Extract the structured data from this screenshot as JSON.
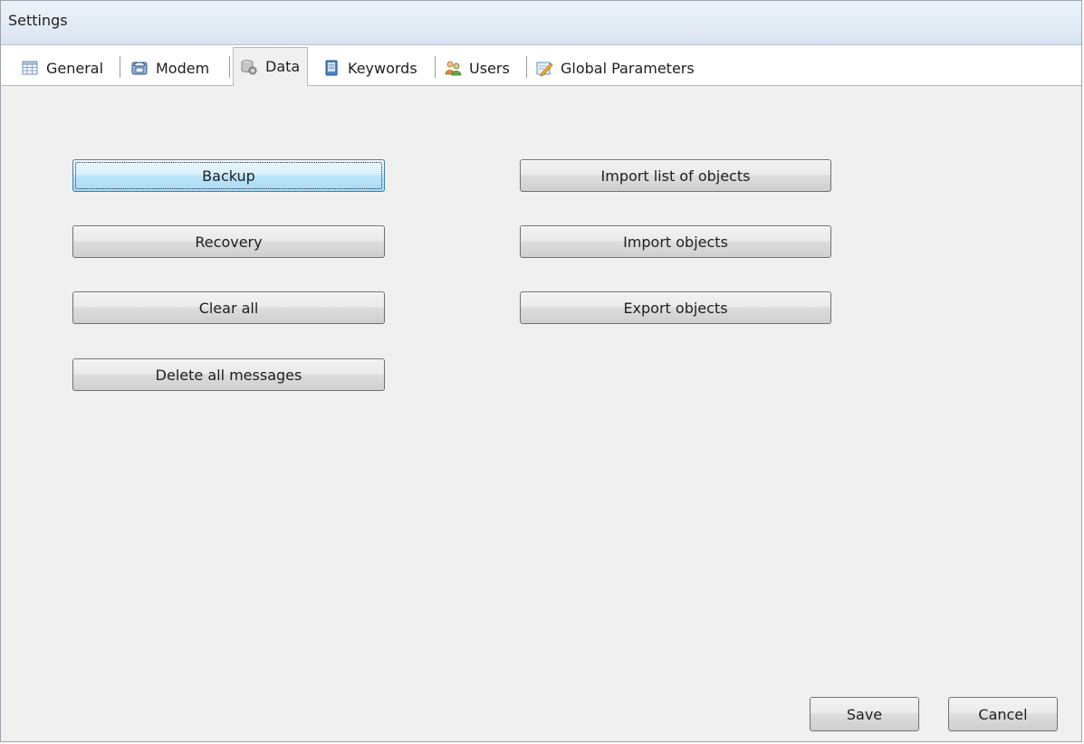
{
  "window": {
    "title": "Settings"
  },
  "tabs": [
    {
      "label": "General",
      "icon": "table-icon",
      "active": false
    },
    {
      "label": "Modem",
      "icon": "phone-icon",
      "active": false
    },
    {
      "label": "Data",
      "icon": "data-gear-icon",
      "active": true
    },
    {
      "label": "Keywords",
      "icon": "book-icon",
      "active": false
    },
    {
      "label": "Users",
      "icon": "users-icon",
      "active": false
    },
    {
      "label": "Global Parameters",
      "icon": "edit-pencil-icon",
      "active": false
    }
  ],
  "data_panel": {
    "left_buttons": [
      {
        "label": "Backup",
        "focused": true
      },
      {
        "label": "Recovery",
        "focused": false
      },
      {
        "label": "Clear all",
        "focused": false
      },
      {
        "label": "Delete all messages",
        "focused": false
      }
    ],
    "right_buttons": [
      {
        "label": "Import list of objects"
      },
      {
        "label": "Import objects"
      },
      {
        "label": "Export objects"
      }
    ]
  },
  "footer": {
    "save_label": "Save",
    "cancel_label": "Cancel"
  },
  "colors": {
    "window_background": "#f0f0f0",
    "title_bar_top": "#eef3fa",
    "title_bar_bottom": "#d9e4f1",
    "focus_border": "#3c7fb1"
  }
}
